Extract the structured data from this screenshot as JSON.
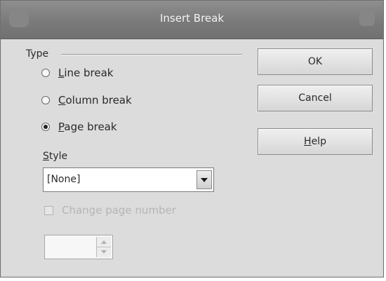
{
  "window": {
    "title": "Insert Break"
  },
  "type_group": {
    "label": "Type",
    "options": [
      {
        "mnemonic": "L",
        "rest": "ine break",
        "checked": false
      },
      {
        "mnemonic": "C",
        "rest": "olumn break",
        "checked": false
      },
      {
        "mnemonic": "P",
        "rest": "age break",
        "checked": true
      }
    ]
  },
  "style": {
    "label_mnemonic": "S",
    "label_rest": "tyle",
    "selected": "[None]"
  },
  "change_page_number": {
    "label": "Change page number",
    "checked": false,
    "enabled": false
  },
  "page_number": {
    "value": ""
  },
  "buttons": {
    "ok": "OK",
    "cancel": "Cancel",
    "help_mnemonic": "H",
    "help_rest": "elp"
  }
}
